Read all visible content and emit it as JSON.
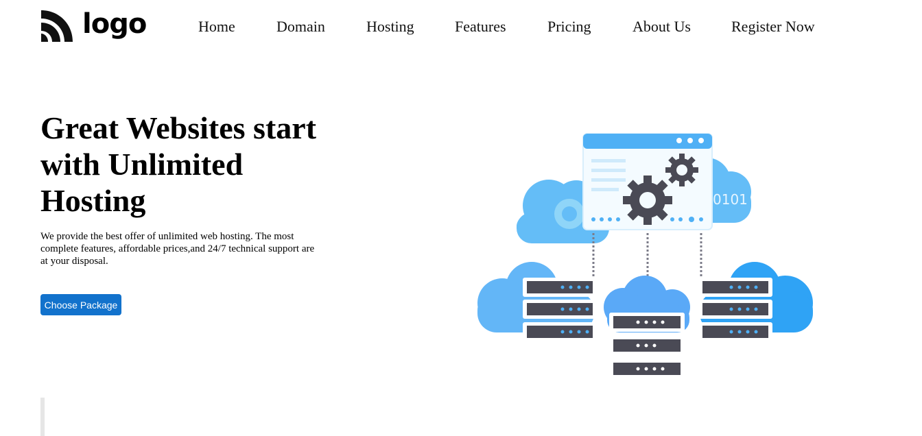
{
  "brand": {
    "logo_text": "logo"
  },
  "nav": {
    "items": [
      {
        "label": "Home"
      },
      {
        "label": "Domain"
      },
      {
        "label": "Hosting"
      },
      {
        "label": "Features"
      },
      {
        "label": "Pricing"
      },
      {
        "label": "About Us"
      },
      {
        "label": "Register Now"
      }
    ]
  },
  "hero": {
    "title": "Great Websites start with Unlimited Hosting",
    "description": "We provide the best offer of unlimited web hosting. The most complete features, affordable prices,and 24/7 technical support are at your disposal.",
    "cta_label": "Choose Package",
    "illustration_text": "0101"
  },
  "colors": {
    "accent": "#1272cc",
    "cloud_blue": "#4fb0f5",
    "server_dark": "#4a4a55"
  }
}
